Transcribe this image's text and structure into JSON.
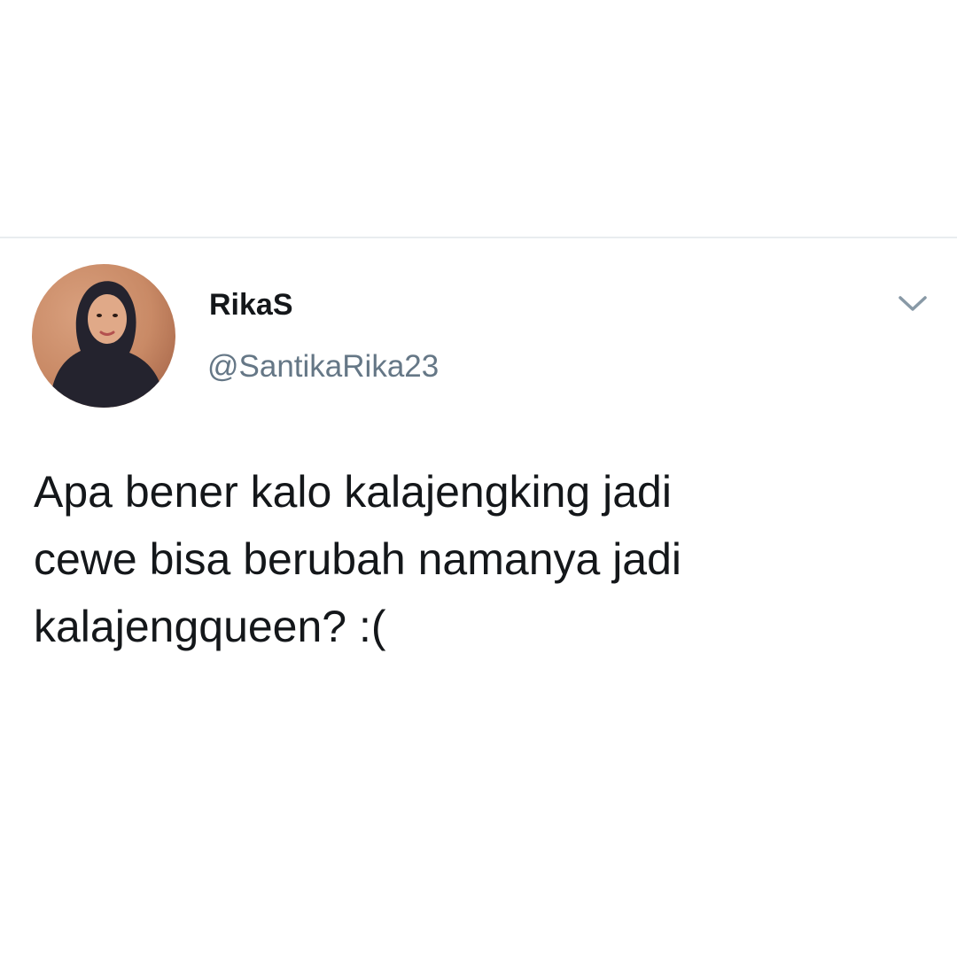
{
  "tweet": {
    "display_name": "RikaS",
    "handle": "@SantikaRika23",
    "text_lines": [
      "Apa bener kalo kalajengking jadi",
      "cewe bisa berubah namanya jadi",
      "kalajengqueen? :("
    ],
    "menu_icon": "chevron-down-icon",
    "avatar_icon": "profile-photo"
  },
  "colors": {
    "background": "#ffffff",
    "name": "#14171a",
    "handle": "#657786",
    "chevron": "#8899a6",
    "divider": "#e9ecef"
  }
}
